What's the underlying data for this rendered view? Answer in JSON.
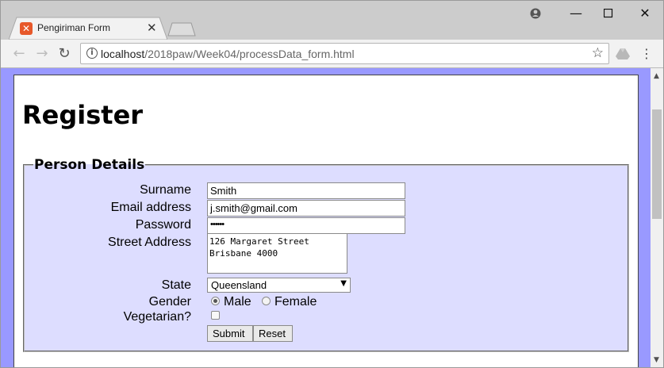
{
  "browser": {
    "tab_title": "Pengiriman Form",
    "url_host": "localhost",
    "url_path": "/2018paw/Week04/processData_form.html"
  },
  "page": {
    "heading": "Register",
    "legend": "Person Details",
    "labels": {
      "surname": "Surname",
      "email": "Email address",
      "password": "Password",
      "street": "Street Address",
      "state": "State",
      "gender": "Gender",
      "vegetarian": "Vegetarian?"
    },
    "values": {
      "surname": "Smith",
      "email": "j.smith@gmail.com",
      "password": "••••••",
      "street": "126 Margaret Street\nBrisbane 4000",
      "state": "Queensland"
    },
    "gender_options": [
      "Male",
      "Female"
    ],
    "gender_selected": "Male",
    "vegetarian_checked": false,
    "buttons": {
      "submit": "Submit",
      "reset": "Reset"
    }
  },
  "colors": {
    "page_bg": "#9999ff",
    "fieldset_bg": "#ddddff"
  }
}
